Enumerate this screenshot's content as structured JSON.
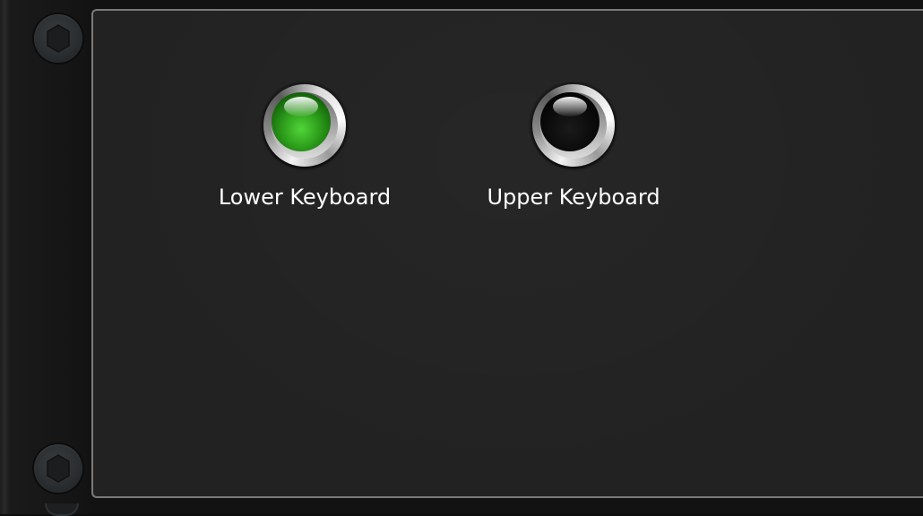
{
  "switches": [
    {
      "label": "Lower Keyboard",
      "state": "on",
      "led_color": "#3cbf2a"
    },
    {
      "label": "Upper Keyboard",
      "state": "off",
      "led_color": "#000000"
    }
  ],
  "colors": {
    "panel_background": "#222222",
    "panel_border": "#7a7a7a",
    "label_text": "#ffffff"
  }
}
